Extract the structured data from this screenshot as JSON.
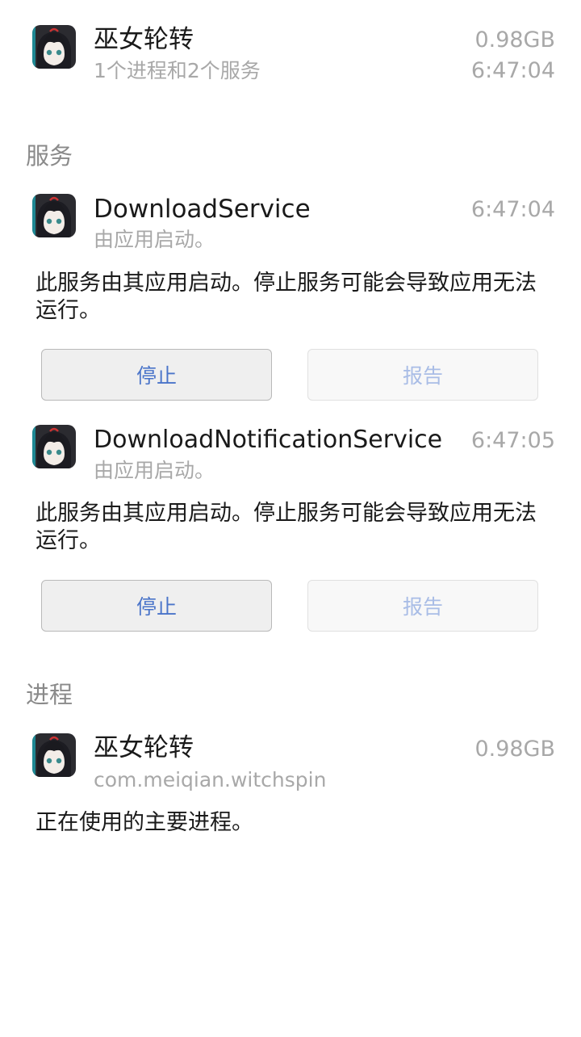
{
  "app": {
    "name": "巫女轮转",
    "summary": "1个进程和2个服务",
    "memory": "0.98GB",
    "time": "6:47:04"
  },
  "services_section": {
    "header": "服务",
    "items": [
      {
        "name": "DownloadService",
        "started_by": "由应用启动。",
        "time": "6:47:04",
        "description": "此服务由其应用启动。停止服务可能会导致应用无法运行。",
        "stop_label": "停止",
        "report_label": "报告"
      },
      {
        "name": "DownloadNotificationService",
        "started_by": "由应用启动。",
        "time": "6:47:05",
        "description": "此服务由其应用启动。停止服务可能会导致应用无法运行。",
        "stop_label": "停止",
        "report_label": "报告"
      }
    ]
  },
  "processes_section": {
    "header": "进程",
    "items": [
      {
        "name": "巫女轮转",
        "package": "com.meiqian.witchspin",
        "memory": "0.98GB",
        "description": "正在使用的主要进程。"
      }
    ]
  },
  "colors": {
    "button_text_active": "#4a74c9",
    "button_text_disabled": "#a9bde6",
    "secondary_text": "#a8a8a8"
  }
}
